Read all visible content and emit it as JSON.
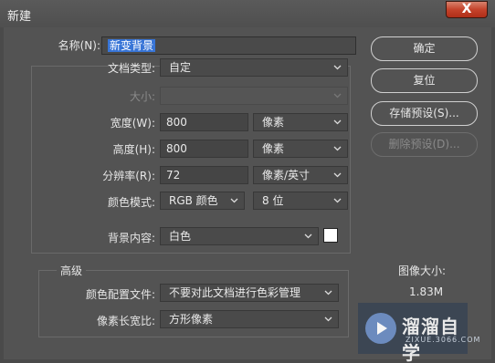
{
  "window": {
    "title": "新建",
    "close_label": "X"
  },
  "form": {
    "name": {
      "label": "名称(N):",
      "value": "新变背景"
    },
    "doc_type": {
      "label": "文档类型:",
      "value": "自定"
    },
    "size": {
      "label": "大小:",
      "value": ""
    },
    "width": {
      "label": "宽度(W):",
      "value": "800",
      "unit": "像素"
    },
    "height": {
      "label": "高度(H):",
      "value": "800",
      "unit": "像素"
    },
    "resolution": {
      "label": "分辨率(R):",
      "value": "72",
      "unit": "像素/英寸"
    },
    "color_mode": {
      "label": "颜色模式:",
      "value": "RGB 颜色",
      "depth": "8 位"
    },
    "background": {
      "label": "背景内容:",
      "value": "白色",
      "swatch_color": "#ffffff"
    }
  },
  "advanced": {
    "legend": "高级",
    "color_profile": {
      "label": "颜色配置文件:",
      "value": "不要对此文档进行色彩管理"
    },
    "pixel_aspect": {
      "label": "像素长宽比:",
      "value": "方形像素"
    }
  },
  "buttons": {
    "ok": "确定",
    "reset": "复位",
    "save_preset": "存储预设(S)...",
    "delete_preset": "删除预设(D)..."
  },
  "image_size": {
    "label": "图像大小:",
    "value": "1.83M"
  },
  "watermark": {
    "title": "溜溜自学",
    "subtitle": "ZIXUE.3066.COM"
  },
  "colors": {
    "dialog_bg": "#535353",
    "selection": "#3875d7",
    "close_red": "#c4432b"
  },
  "icons": [
    "close-icon",
    "chevron-down-icon",
    "play-logo-icon"
  ]
}
